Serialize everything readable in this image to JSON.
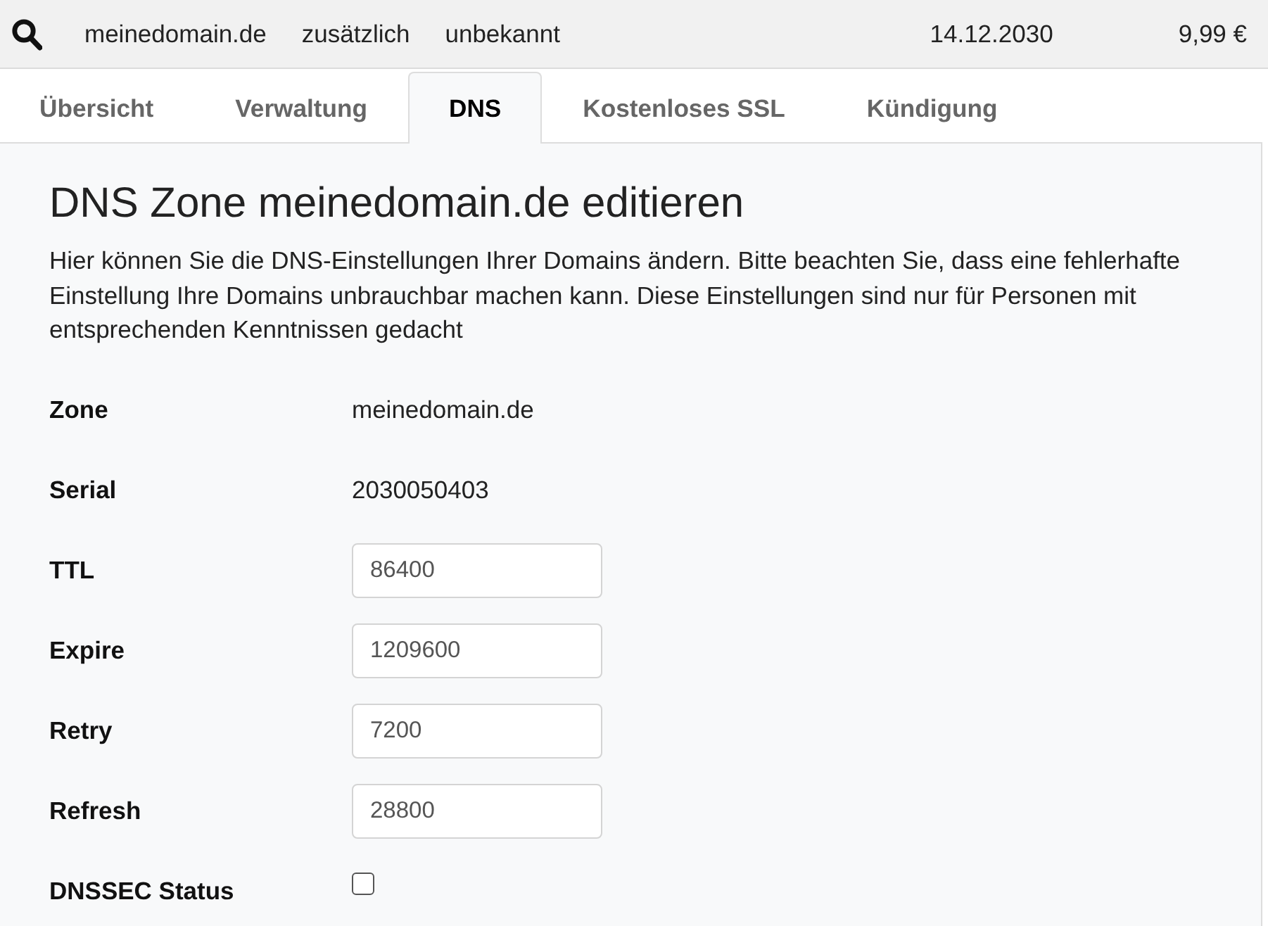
{
  "top_bar": {
    "domain": "meinedomain.de",
    "column_2": "zusätzlich",
    "column_3": "unbekannt",
    "date": "14.12.2030",
    "price": "9,99 €"
  },
  "tabs": [
    {
      "label": "Übersicht",
      "selected": false
    },
    {
      "label": "Verwaltung",
      "selected": false
    },
    {
      "label": "DNS",
      "selected": true
    },
    {
      "label": "Kostenloses SSL",
      "selected": false
    },
    {
      "label": "Kündigung",
      "selected": false
    }
  ],
  "zone_editor": {
    "title": "DNS Zone meinedomain.de editieren",
    "description": "Hier können Sie die DNS-Einstellungen Ihrer Domains ändern. Bitte beachten Sie, dass eine fehlerhafte Einstellung Ihre Domains unbrauchbar machen kann. Diese Einstellungen sind nur für Personen mit entsprechenden Kenntnissen gedacht",
    "fields": [
      {
        "kind": "text",
        "label": "Zone",
        "value": "meinedomain.de"
      },
      {
        "kind": "text",
        "label": "Serial",
        "value": "2030050403"
      },
      {
        "kind": "input",
        "label": "TTL",
        "value": "86400"
      },
      {
        "kind": "input",
        "label": "Expire",
        "value": "1209600"
      },
      {
        "kind": "input",
        "label": "Retry",
        "value": "7200"
      },
      {
        "kind": "input",
        "label": "Refresh",
        "value": "28800"
      },
      {
        "kind": "checkbox",
        "label": "DNSSEC Status",
        "checked": false
      }
    ]
  }
}
